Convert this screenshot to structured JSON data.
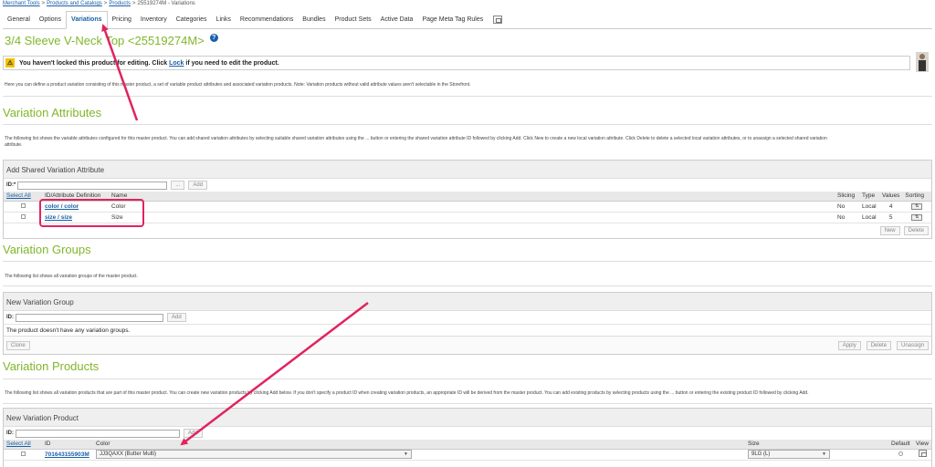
{
  "breadcrumb": [
    "Merchant Tools",
    "Products and Catalogs",
    "Products",
    "25519274M - Variations"
  ],
  "tabs": [
    {
      "label": "General"
    },
    {
      "label": "Options"
    },
    {
      "label": "Variations",
      "active": true
    },
    {
      "label": "Pricing"
    },
    {
      "label": "Inventory"
    },
    {
      "label": "Categories"
    },
    {
      "label": "Links"
    },
    {
      "label": "Recommendations"
    },
    {
      "label": "Bundles"
    },
    {
      "label": "Product Sets"
    },
    {
      "label": "Active Data"
    },
    {
      "label": "Page Meta Tag Rules"
    }
  ],
  "page_title": "3/4 Sleeve V-Neck Top <25519274M>",
  "lock_notice": {
    "before": "You haven't locked this product for editing. Click ",
    "link": "Lock",
    "after": " if you need to edit the product."
  },
  "intro_text": "Here you can define a product variation consisting of this master product, a set of variable product attributes and associated variation products. Note: Variation products without valid attribute values aren't selectable in the Storefront.",
  "variation_attributes": {
    "title": "Variation Attributes",
    "desc_line1": "The following list shows the variable attributes configured for this master product. You can add shared variation attributes by selecting suitable shared variation attributes using the ... button or entering the shared variation attribute ID followed by clicking Add. Click New to create a new local variation attribute. Click Delete to delete a selected local variation attributes, or to unassign a selected shared variation",
    "desc_line2": "attribute.",
    "panel_title": "Add Shared Variation Attribute",
    "id_label": "ID:*",
    "browse_label": "...",
    "add_label": "Add",
    "columns": {
      "select_all": "Select All",
      "id": "ID/Attribute Definition",
      "name": "Name",
      "slicing": "Slicing",
      "type": "Type",
      "values": "Values",
      "sorting": "Sorting"
    },
    "rows": [
      {
        "id": "color / color",
        "name": "Color",
        "slicing": "No",
        "type": "Local",
        "values": "4"
      },
      {
        "id": "size / size",
        "name": "Size",
        "slicing": "No",
        "type": "Local",
        "values": "5"
      }
    ],
    "new_label": "New",
    "delete_label": "Delete"
  },
  "variation_groups": {
    "title": "Variation Groups",
    "desc": "The following list shows all variation groups of the master product.",
    "panel_title": "New Variation Group",
    "id_label": "ID:",
    "add_label": "Add",
    "empty_text": "The product doesn't have any variation groups.",
    "clone_label": "Clone",
    "apply_label": "Apply",
    "delete_label": "Delete",
    "unassign_label": "Unassign"
  },
  "variation_products": {
    "title": "Variation Products",
    "desc": "The following list shows all variation products that are part of this master product. You can create new variation products by clicking Add below. If you don't specify a product ID when creating variation products, an appropriate ID will be derived from the master product. You can add existing products by selecting products using the ... button or entering the existing product ID followed by clicking Add.",
    "panel_title": "New Variation Product",
    "id_label": "ID:",
    "add_label": "Add",
    "columns": {
      "select_all": "Select All",
      "id": "ID",
      "color": "Color",
      "size": "Size",
      "default": "Default",
      "view": "View"
    },
    "rows": [
      {
        "id": "701643155903M",
        "color": "JJ3QAXX (Butter Multi)",
        "size": "9LG (L)"
      }
    ]
  },
  "colors": {
    "accent_green": "#7fb72a",
    "link_blue": "#1a5fa8",
    "annotation_red": "#e0245e"
  }
}
